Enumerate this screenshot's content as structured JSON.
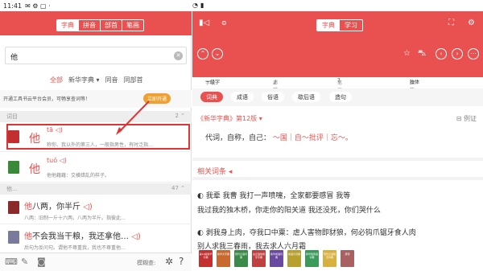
{
  "status": {
    "time": "11:41",
    "battery": "99%"
  },
  "left": {
    "tabs": [
      "字典",
      "拼音",
      "部首",
      "笔画"
    ],
    "search_value": "他",
    "filters": [
      "全部",
      "新华字典 ▾",
      "同音",
      "同部首"
    ],
    "promo_text": "开通工具书云平台会员，可畅享查词等！",
    "promo_button": "立即开通",
    "section1": {
      "label": "词目",
      "count": "2 ⌃"
    },
    "entries": [
      {
        "char": "他",
        "pinyin": "tā",
        "def": "称你、我以外的第三人，一般指男性，有时泛指…"
      },
      {
        "char": "他",
        "pinyin": "tuó",
        "def": "他他藉藉：交横错乱的样子。"
      }
    ],
    "section2": {
      "label": "他…",
      "count": "47 ⌃"
    },
    "words": [
      {
        "head": "他",
        "rest": "八两，你半斤",
        "def": "八两：旧制一斤十六两，八两为半斤。指彼此…"
      },
      {
        "head": "他",
        "rest": "不会我当干粮，我还拿他…",
        "def": "后句为反问句。谓他不尊重我，我也不尊重他…"
      }
    ],
    "footer_mode": "模糊查:"
  },
  "right": {
    "tabs": [
      "字典",
      "学习"
    ],
    "info": {
      "zixing_label": "字级:",
      "zixing": "一级字",
      "bushou_label": "部首:",
      "bushou": "丿",
      "bihua_label": "笔画:",
      "bihua": "7",
      "jiegou_label": "结构:",
      "jiegou": "独体"
    },
    "chips": [
      "词典",
      "成语",
      "俗语",
      "歇后语",
      "造句"
    ],
    "dict_title": "《新华字典》第12版 ▾",
    "example_label": "例证",
    "meaning": {
      "text": "代词，自称，自己：",
      "links": "～国｜自～批评｜忘～。"
    },
    "related_label": "相关词条 ◂",
    "lines": [
      "◐ 我辈  我曹  我打一声喷嚏，全家都要感冒  我等",
      "     我过我的独木桥，你走你的阳关道  我还没死，你们哭什么",
      "◐ 剥我身上肉，夺我口中粟：虐人害物即豺狼，何必钩爪锯牙食人肉",
      "     别人求我三春雨，我去求人六月霜"
    ],
    "books": [
      "第12版新华字典",
      "新华大字典",
      "现代汉语词典",
      "古汉语常用字字典",
      "新华成语词典",
      "成语大词典",
      "新华惯用语词典",
      "现代汉语规范词典",
      "辞源"
    ]
  }
}
